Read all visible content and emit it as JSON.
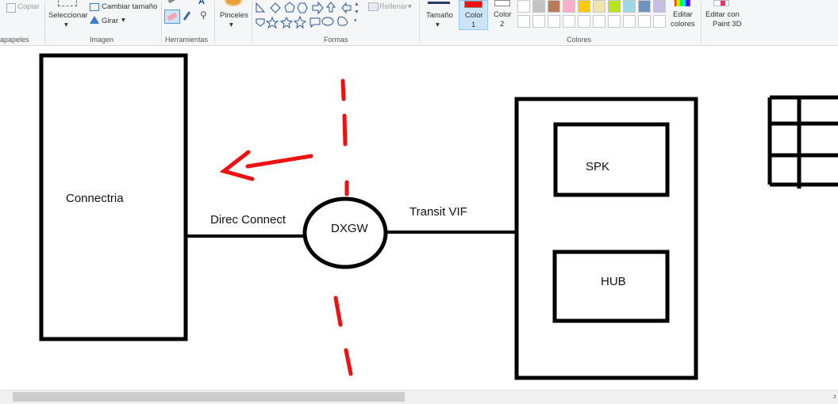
{
  "ribbon": {
    "clipboard": {
      "copy_label": "Copiar",
      "group_label": "apapeles"
    },
    "image": {
      "select_label": "Seleccionar",
      "resize_label": "Cambiar tamaño",
      "rotate_label": "Girar",
      "group_label": "Imagen"
    },
    "tools": {
      "group_label": "Herramientas"
    },
    "brushes": {
      "label": "Pinceles"
    },
    "shapes": {
      "fill_label": "Rellenar",
      "group_label": "Formas"
    },
    "size": {
      "label": "Tamaño"
    },
    "color1": {
      "label": "Color",
      "number": "1",
      "color": "#ee1111"
    },
    "color2": {
      "label": "Color",
      "number": "2",
      "color": "#ffffff"
    },
    "colors": {
      "group_label": "Colores",
      "edit_label_1": "Editar",
      "edit_label_2": "colores",
      "palette_row1": [
        "#ffffff",
        "#c3c3c3",
        "#b97a57",
        "#ffaec9",
        "#ffc90e",
        "#efe4b0",
        "#b5e61d",
        "#99d9ea",
        "#7092be",
        "#c8bfe7"
      ],
      "palette_row2": [
        "#ffffff",
        "#ffffff",
        "#ffffff",
        "#ffffff",
        "#ffffff",
        "#ffffff",
        "#ffffff",
        "#ffffff",
        "#ffffff",
        "#ffffff"
      ]
    },
    "paint3d": {
      "label_1": "Editar con",
      "label_2": "Paint 3D"
    }
  },
  "canvas": {
    "left_box_label": "Connectria",
    "link1_label": "Direc Connect",
    "circle_label": "DXGW",
    "link2_label": "Transit VIF",
    "box_top_label": "SPK",
    "box_bottom_label": "HUB"
  }
}
